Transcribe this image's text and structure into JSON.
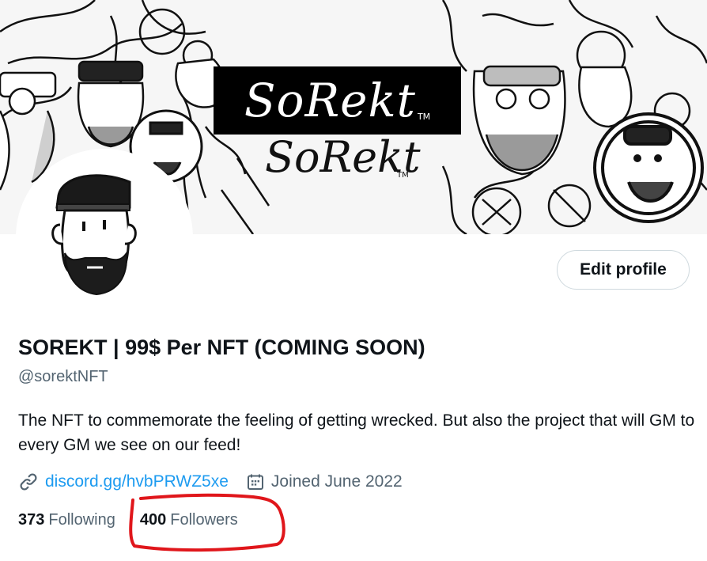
{
  "banner": {
    "logo_text": "SoRekt",
    "logo_tm": "TM",
    "sub_logo_text": "SoRekt",
    "sub_logo_tm": "TM"
  },
  "profile": {
    "display_name": "SOREKT | 99$ Per NFT (COMING SOON)",
    "handle": "@sorektNFT",
    "bio": "The NFT to commemorate the feeling of getting wrecked. But also the project that will GM to every GM we see on our feed!",
    "website": "discord.gg/hvbPRWZ5xe",
    "joined": "Joined June 2022",
    "edit_profile_label": "Edit profile"
  },
  "stats": {
    "following_count": "373",
    "following_label": "Following",
    "followers_count": "400",
    "followers_label": "Followers"
  },
  "icons": {
    "website": "link-icon",
    "joined": "calendar-icon"
  },
  "colors": {
    "link": "#1d9bf0",
    "secondary_text": "#536471",
    "primary_text": "#0f1419",
    "annotation": "#e0161b"
  }
}
